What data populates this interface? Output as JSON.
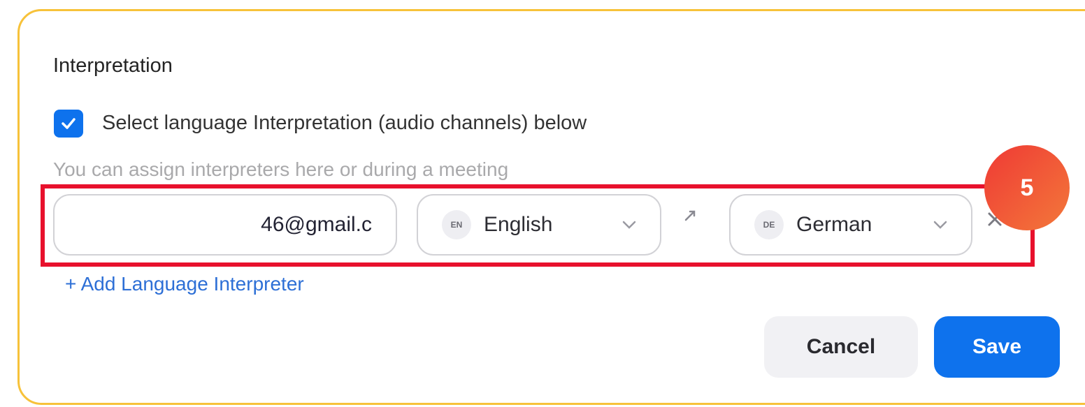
{
  "section": {
    "title": "Interpretation",
    "checkbox_label": "Select language Interpretation (audio channels) below",
    "checkbox_checked": true,
    "hint": "You can assign interpreters here or during a meeting"
  },
  "interpreter_row": {
    "email_value": "46@gmail.c",
    "source_language": {
      "code": "EN",
      "name": "English"
    },
    "target_language": {
      "code": "DE",
      "name": "German"
    }
  },
  "add_link": "+ Add Language Interpreter",
  "annotation": {
    "step_number": "5"
  },
  "buttons": {
    "cancel": "Cancel",
    "save": "Save"
  },
  "colors": {
    "accent_blue": "#0e72ed",
    "highlight_red": "#e8112d",
    "frame_yellow": "#f7c23a",
    "badge_gradient_start": "#ef3a35",
    "badge_gradient_end": "#f3783a"
  },
  "icons": {
    "checkbox": "check-icon",
    "dropdown": "chevron-down-icon",
    "swap": "swap-arrows-icon",
    "remove": "close-icon"
  }
}
